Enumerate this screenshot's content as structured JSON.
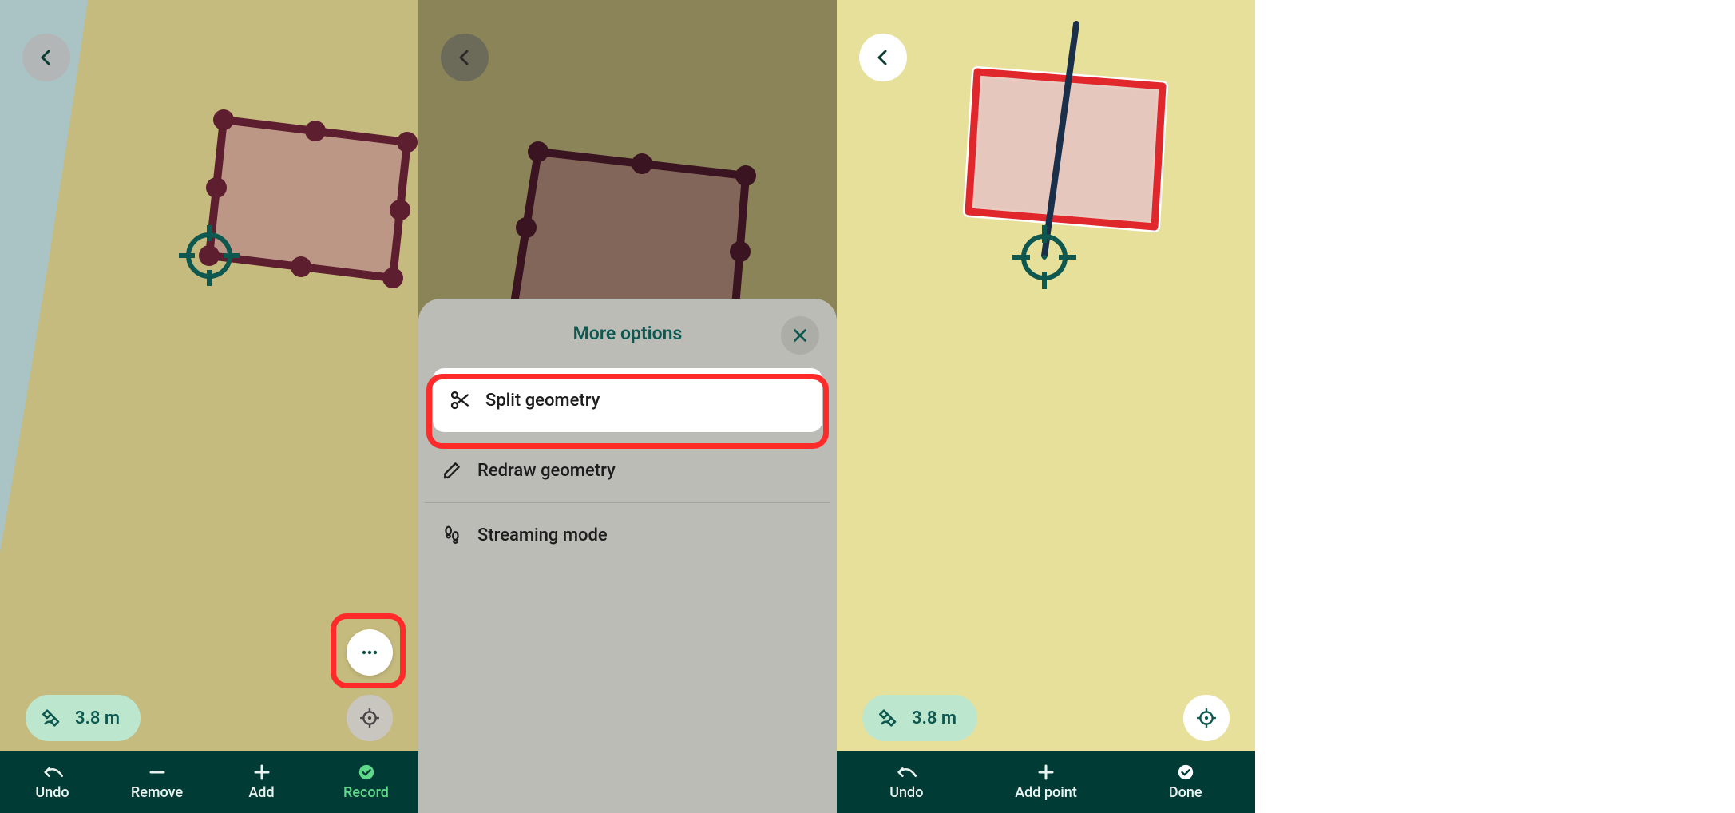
{
  "panel1": {
    "distance": "3.8 m",
    "nav": {
      "undo": "Undo",
      "remove": "Remove",
      "add": "Add",
      "record": "Record"
    }
  },
  "panel2": {
    "sheet_title": "More options",
    "options": {
      "split": "Split geometry",
      "redraw": "Redraw geometry",
      "streaming": "Streaming mode"
    }
  },
  "panel3": {
    "distance": "3.8 m",
    "nav": {
      "undo": "Undo",
      "add_point": "Add point",
      "done": "Done"
    }
  },
  "colors": {
    "teal_dark": "#003c35",
    "mint": "#bde6cf",
    "red": "#e0272b",
    "maroon": "#5d1e2f",
    "highlight": "#ff2a2a"
  }
}
